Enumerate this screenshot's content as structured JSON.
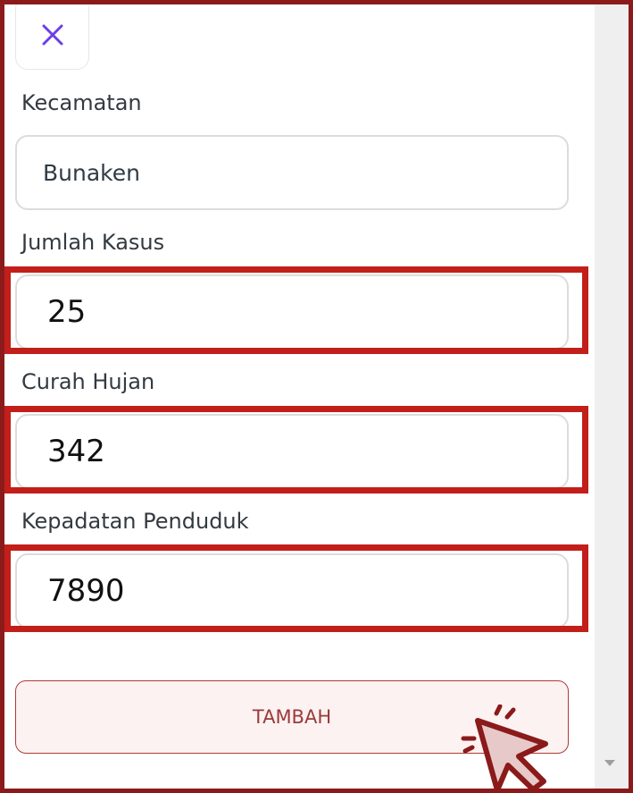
{
  "form": {
    "close_icon": "close-icon",
    "fields": [
      {
        "label": "Kecamatan",
        "value": "Bunaken"
      },
      {
        "label": "Jumlah Kasus",
        "value": "25"
      },
      {
        "label": "Curah Hujan",
        "value": "342"
      },
      {
        "label": "Kepadatan Penduduk",
        "value": "7890"
      }
    ],
    "submit_label": "TAMBAH"
  },
  "colors": {
    "accent": "#6b3ee8",
    "highlight": "#c21f1a",
    "frame": "#8b1a1a",
    "button_text": "#9b3a3a"
  },
  "cursor_icon": "click-cursor-icon"
}
